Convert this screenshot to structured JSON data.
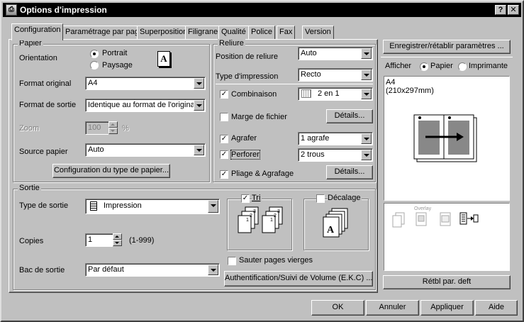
{
  "window": {
    "title": "Options d'impression",
    "help_label": "?",
    "close_label": "✕"
  },
  "tabs": [
    {
      "label": "Configuration"
    },
    {
      "label": "Paramétrage par page"
    },
    {
      "label": "Superposition"
    },
    {
      "label": "Filigrane"
    },
    {
      "label": "Qualité"
    },
    {
      "label": "Police"
    },
    {
      "label": "Fax"
    },
    {
      "label": "Version"
    }
  ],
  "papier": {
    "legend": "Papier",
    "orientation_label": "Orientation",
    "portrait_label": "Portrait",
    "paysage_label": "Paysage",
    "orientation_selected": "Portrait",
    "format_original_label": "Format original",
    "format_original_value": "A4",
    "format_sortie_label": "Format de sortie",
    "format_sortie_value": "Identique au format de l'original",
    "zoom_label": "Zoom",
    "zoom_value": "100",
    "zoom_unit": "%",
    "source_label": "Source papier",
    "source_value": "Auto",
    "config_button": "Configuration du type de papier..."
  },
  "reliure": {
    "legend": "Reliure",
    "position_label": "Position de reliure",
    "position_value": "Auto",
    "type_label": "Type d'impression",
    "type_value": "Recto",
    "combinaison_label": "Combinaison",
    "combinaison_value": "2 en 1",
    "marge_label": "Marge de fichier",
    "marge_details": "Détails...",
    "agrafer_label": "Agrafer",
    "agrafer_value": "1 agrafe",
    "perforer_label": "Perforer",
    "perforer_value": "2 trous",
    "pliage_label": "Pliage & Agrafage",
    "pliage_details": "Détails..."
  },
  "sortie": {
    "legend": "Sortie",
    "type_label": "Type de sortie",
    "type_value": "Impression",
    "copies_label": "Copies",
    "copies_value": "1",
    "copies_range": "(1-999)",
    "bac_label": "Bac de sortie",
    "bac_value": "Par défaut",
    "tri_label": "Tri",
    "decalage_label": "Décalage",
    "sauter_label": "Sauter pages vierges",
    "auth_button": "Authentification/Suivi de Volume (E.K.C) ..."
  },
  "right_panel": {
    "save_button": "Enregistrer/rétablir paramètres ...",
    "afficher_label": "Afficher",
    "papier_radio": "Papier",
    "imprimante_radio": "Imprimante",
    "preview_size": "A4",
    "preview_dims": "(210x297mm)",
    "overlay_label": "Overlay",
    "restore_button": "Rétbl par. deft"
  },
  "footer": {
    "ok": "OK",
    "annuler": "Annuler",
    "appliquer": "Appliquer",
    "aide": "Aide"
  }
}
